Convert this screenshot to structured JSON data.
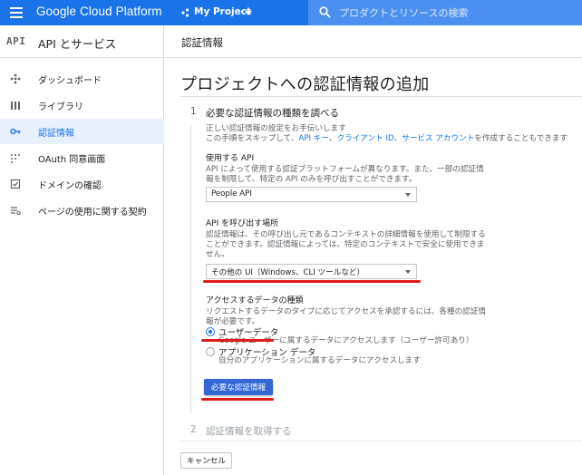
{
  "header": {
    "brand": "Google Cloud Platform",
    "project": "My Project",
    "search_placeholder": "プロダクトとリソースの検索"
  },
  "sidebar": {
    "logo": "API",
    "title": "API とサービス",
    "items": [
      {
        "label": "ダッシュボード",
        "icon": "dashboard-icon",
        "active": false
      },
      {
        "label": "ライブラリ",
        "icon": "library-icon",
        "active": false
      },
      {
        "label": "認証情報",
        "icon": "key-icon",
        "active": true
      },
      {
        "label": "OAuth 同意画面",
        "icon": "oauth-icon",
        "active": false
      },
      {
        "label": "ドメインの確認",
        "icon": "domain-check-icon",
        "active": false
      },
      {
        "label": "ページの使用に関する契約",
        "icon": "agreement-icon",
        "active": false
      }
    ]
  },
  "main": {
    "section_title": "認証情報",
    "page_title": "プロジェクトへの認証情報の追加",
    "step1": {
      "number": "1",
      "title": "必要な認証情報の種類を調べる",
      "intro_line1": "正しい認証情報の設定をお手伝いします",
      "intro_line2_prefix": "この手順をスキップして、",
      "link_api_key": "API キー",
      "sep1": "、",
      "link_client_id": "クライアント ID",
      "sep2": "、",
      "link_service_account": "サービス アカウント",
      "intro_line2_suffix": "を作成することもできます",
      "api_label": "使用する API",
      "api_desc_line1": "API によって使用する認証プラットフォームが異なります。また、一部の認証情",
      "api_desc_line2": "報を制限して、特定の API のみを呼び出すことができます。",
      "api_value": "People API",
      "caller_label": "API を呼び出す場所",
      "caller_desc_line1": "認証情報は、その呼び出し元であるコンテキストの詳細情報を使用して制限する",
      "caller_desc_line2": "ことができます。認証情報によっては、特定のコンテキストで安全に使用できま",
      "caller_desc_line3": "せん。",
      "caller_value": "その他の UI（Windows、CLI ツールなど）",
      "data_label": "アクセスするデータの種類",
      "data_desc_line1": "リクエストするデータのタイプに応じてアクセスを承認するには、各種の認証情",
      "data_desc_line2": "報が必要です。",
      "option_user": "ユーザーデータ",
      "option_user_desc": "Google ユーザーに属するデータにアクセスします（ユーザー許可あり）",
      "option_app": "アプリケーション データ",
      "option_app_desc": "自分のアプリケーションに属するデータにアクセスします",
      "submit": "必要な認証情報"
    },
    "step2": {
      "number": "2",
      "title": "認証情報を取得する"
    },
    "cancel": "キャンセル"
  },
  "colors": {
    "topbar": "#1a73e8",
    "active_nav": "#e8f0fe",
    "primary_button": "#3367d6",
    "annotation_red": "#e01b1b"
  }
}
